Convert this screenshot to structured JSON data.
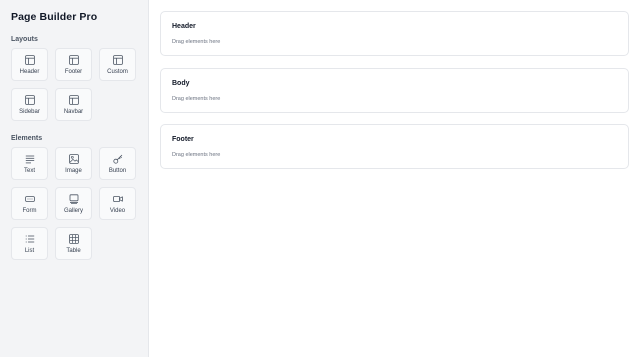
{
  "sidebar": {
    "title": "Page Builder Pro",
    "layouts": {
      "heading": "Layouts",
      "items": [
        {
          "label": "Header",
          "icon": "layout-icon"
        },
        {
          "label": "Footer",
          "icon": "layout-icon"
        },
        {
          "label": "Custom",
          "icon": "layout-icon"
        },
        {
          "label": "Sidebar",
          "icon": "layout-icon"
        },
        {
          "label": "Navbar",
          "icon": "layout-icon"
        }
      ]
    },
    "elements": {
      "heading": "Elements",
      "items": [
        {
          "label": "Text",
          "icon": "text-lines-icon"
        },
        {
          "label": "Image",
          "icon": "image-icon"
        },
        {
          "label": "Button",
          "icon": "key-icon"
        },
        {
          "label": "Form",
          "icon": "form-field-icon"
        },
        {
          "label": "Gallery",
          "icon": "gallery-icon"
        },
        {
          "label": "Video",
          "icon": "video-camera-icon"
        },
        {
          "label": "List",
          "icon": "list-icon"
        },
        {
          "label": "Table",
          "icon": "table-icon"
        }
      ]
    }
  },
  "canvas": {
    "zones": [
      {
        "title": "Header",
        "hint": "Drag elements here"
      },
      {
        "title": "Body",
        "hint": "Drag elements here"
      },
      {
        "title": "Footer",
        "hint": "Drag elements here"
      }
    ]
  },
  "colors": {
    "sidebar_bg": "#f3f4f6",
    "tile_bg": "#f9fafb",
    "border": "#e5e7eb",
    "icon_stroke": "#4b5563"
  }
}
